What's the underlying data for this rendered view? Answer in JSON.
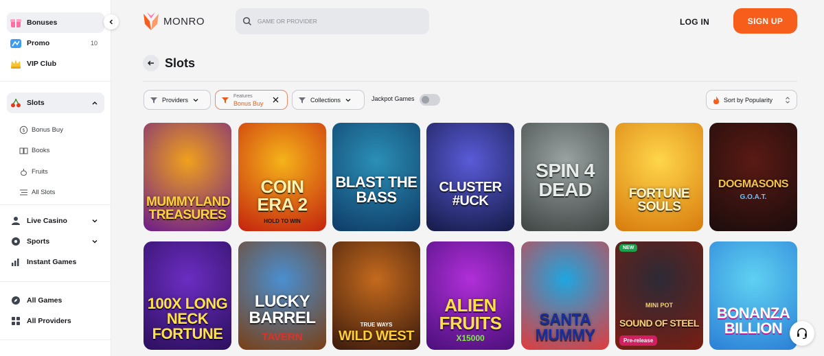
{
  "brand": {
    "name": "MONRO",
    "accent": "#f75d1b"
  },
  "header": {
    "search_placeholder": "GAME OR PROVIDER",
    "login_label": "LOG IN",
    "signup_label": "SIGN UP"
  },
  "sidebar": {
    "top_items": [
      {
        "label": "Bonuses",
        "icon": "gift-icon"
      },
      {
        "label": "Promo",
        "icon": "promo-icon",
        "count": "10"
      },
      {
        "label": "VIP Club",
        "icon": "crown-icon"
      }
    ],
    "slots": {
      "label": "Slots",
      "icon": "cherry-icon"
    },
    "slot_subitems": [
      {
        "label": "Bonus Buy",
        "icon": "coin-icon"
      },
      {
        "label": "Books",
        "icon": "book-icon"
      },
      {
        "label": "Fruits",
        "icon": "fruit-icon"
      },
      {
        "label": "All Slots",
        "icon": "list-icon"
      }
    ],
    "categories": [
      {
        "label": "Live Casino",
        "icon": "person-icon"
      },
      {
        "label": "Sports",
        "icon": "ball-icon"
      },
      {
        "label": "Instant Games",
        "icon": "bar-chart-icon"
      }
    ],
    "bottom": [
      {
        "label": "All Games",
        "icon": "compass-icon"
      },
      {
        "label": "All Providers",
        "icon": "grid-icon"
      }
    ]
  },
  "page": {
    "title": "Slots"
  },
  "filters": {
    "providers": "Providers",
    "features_key": "Features",
    "features_value": "Bonus Buy",
    "collections": "Collections",
    "jackpot": "Jackpot Games",
    "sort": "Sort by Popularity"
  },
  "games": [
    {
      "title": "MUMMYLAND TREASURES",
      "bg1": "#f0a11c",
      "bg2": "#6a1b8c",
      "fg": "#ffd23a"
    },
    {
      "title": "COIN ERA 2",
      "sub": "HOLD TO WIN",
      "bg1": "#f5b31a",
      "bg2": "#c4220e",
      "fg": "#fff2b0"
    },
    {
      "title": "BLAST THE BASS",
      "bg1": "#2b8fb6",
      "bg2": "#0e3b66",
      "fg": "#ffffff"
    },
    {
      "title": "CLUSTER #UCK",
      "bg1": "#5a5bd8",
      "bg2": "#141a46",
      "fg": "#ffffff"
    },
    {
      "title": "SPIN 4 DEAD",
      "bg1": "#9aa2a2",
      "bg2": "#3e4543",
      "fg": "#e7ece9"
    },
    {
      "title": "FORTUNE SOULS",
      "bg1": "#ffd64a",
      "bg2": "#d77a0d",
      "fg": "#fff6d2"
    },
    {
      "title": "DOGMASONS",
      "sub": "G.O.A.T.",
      "bg1": "#5a1a14",
      "bg2": "#1a0c0c",
      "fg": "#f1c34b"
    },
    {
      "title": "100x LONG NECK FORTUNE",
      "bg1": "#6c2dc2",
      "bg2": "#2b0f5c",
      "fg": "#ffe14a"
    },
    {
      "title": "LUCKY BARREL",
      "sub": "TAVERN",
      "bg1": "#4a8fd1",
      "bg2": "#7a3f14",
      "fg": "#ffffff"
    },
    {
      "title": "WILD WEST",
      "sub": "TRUE WAYS",
      "bg1": "#c46a1e",
      "bg2": "#3a1a0c",
      "fg": "#ffcc33"
    },
    {
      "title": "ALIEN FRUITS",
      "sub": "X15000",
      "bg1": "#b02fd8",
      "bg2": "#4a0f7a",
      "fg": "#ffe04a"
    },
    {
      "title": "SANTA MUMMY",
      "bg1": "#1ea6e0",
      "bg2": "#e23b3b",
      "fg": "#1a2f9c"
    },
    {
      "title": "SOUND OF STEEL",
      "sub": "MINI POT",
      "bg1": "#2c2a36",
      "bg2": "#7a1e12",
      "fg": "#f4d27a",
      "new": "NEW",
      "pre": "Pre-release"
    },
    {
      "title": "BONANZA BILLION",
      "bg1": "#5fd1f2",
      "bg2": "#2b7fd6",
      "fg": "#ffffff"
    }
  ]
}
